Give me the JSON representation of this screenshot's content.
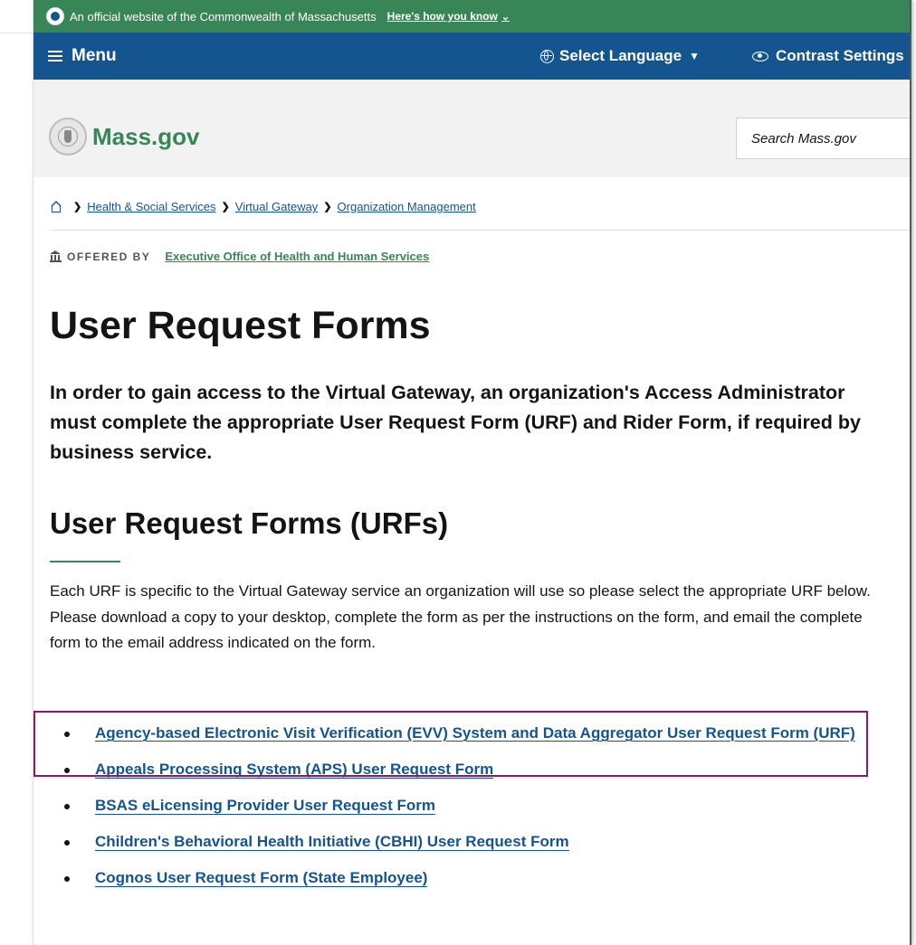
{
  "official_banner": {
    "text": "An official website of the Commonwealth of Massachusetts",
    "how_you_know": "Here's how you know"
  },
  "menubar": {
    "menu_label": "Menu",
    "language_label": "Select Language",
    "contrast_label": "Contrast Settings"
  },
  "header": {
    "logo_text": "Mass.gov",
    "search_placeholder": "Search Mass.gov"
  },
  "breadcrumb": {
    "items": [
      "Health & Social Services",
      "Virtual Gateway",
      "Organization Management"
    ]
  },
  "offered_by": {
    "label": "OFFERED BY",
    "agency": "Executive Office of Health and Human Services"
  },
  "page": {
    "title": "User Request Forms",
    "intro": "In order to gain access to the Virtual Gateway, an organization's Access Administrator must complete the appropriate User Request Form (URF) and Rider Form, if required by business service.",
    "section_title": "User Request Forms (URFs)",
    "section_body": "Each URF is specific to the Virtual Gateway service an organization will use so please select the appropriate URF below. Please download a copy to your desktop, complete the form as per the instructions on the form, and email the complete form to the email address indicated on the form."
  },
  "forms": [
    "Agency-based Electronic Visit Verification (EVV) System and Data Aggregator User Request Form (URF)",
    "Appeals Processing System (APS) User Request Form",
    "BSAS eLicensing Provider User Request Form",
    "Children's Behavioral Health Initiative (CBHI) User Request Form",
    "Cognos User Request Form (State Employee)"
  ],
  "colors": {
    "official_green": "#388557",
    "nav_blue": "#14558f",
    "link_blue": "#14558f",
    "highlight": "#8c1a6a"
  }
}
